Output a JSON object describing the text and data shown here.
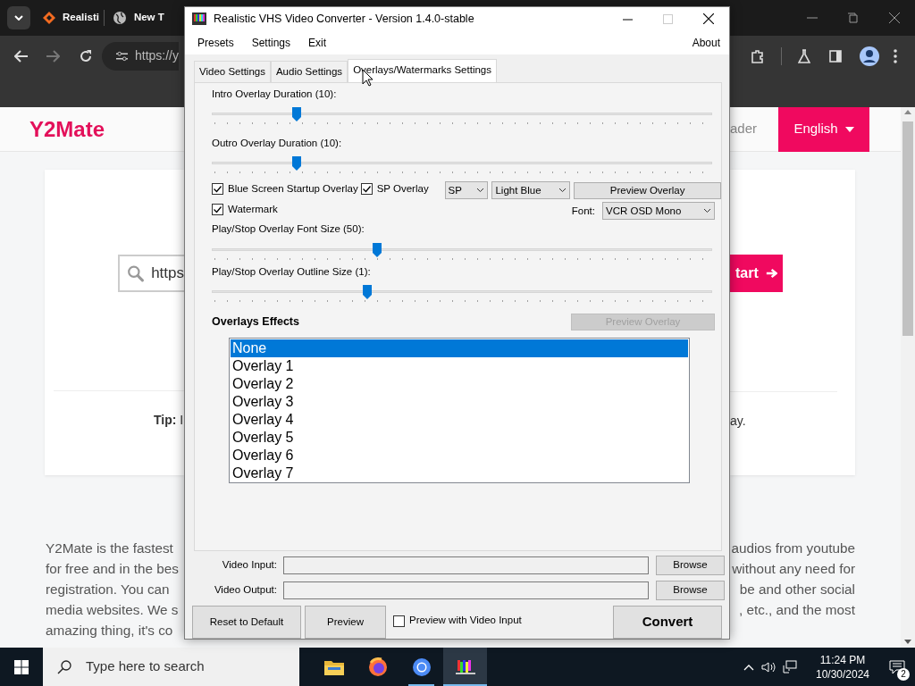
{
  "browser": {
    "tabs": [
      {
        "title": "Realisti",
        "kind": "diamond"
      },
      {
        "title": "New T",
        "kind": "globe"
      }
    ],
    "address": "https://y"
  },
  "page": {
    "logo": "Y2Mate",
    "nav_link": "ader",
    "language_button": "English",
    "search_value": "https",
    "start_button": "tart",
    "tip_label": "Tip:",
    "tip_left": "I",
    "tip_right": "ay.",
    "paragraph_left": [
      "Y2Mate is the fastest",
      "for free and in the bes",
      "registration. You can",
      "media websites. We s",
      "amazing thing, it's co"
    ],
    "paragraph_right": [
      "audios from youtube",
      "without any need for",
      "be and other social",
      ", etc., and the most"
    ]
  },
  "dialog": {
    "title": "Realistic VHS Video Converter - Version 1.4.0-stable",
    "menu": [
      "Presets",
      "Settings",
      "Exit"
    ],
    "about": "About",
    "tabs": [
      {
        "label": "Video Settings",
        "selected": false
      },
      {
        "label": "Audio Settings",
        "selected": false
      },
      {
        "label": "Overlays/Watermarks Settings",
        "selected": true
      }
    ],
    "duration_sliders": [
      {
        "label": "Intro Overlay Duration (10):",
        "level": 0.17
      },
      {
        "label": "Outro Overlay Duration (10):",
        "level": 0.17
      }
    ],
    "checkboxes": [
      {
        "label": "Blue Screen Startup Overlay",
        "checked": true
      },
      {
        "label": "SP Overlay",
        "checked": true
      },
      {
        "label": "Watermark",
        "checked": true
      }
    ],
    "speed_select": "SP",
    "color_select": "Light Blue",
    "preview_overlay_button": {
      "label": "Preview Overlay",
      "disabled": false
    },
    "font_label": "Font:",
    "font_select": "VCR OSD Mono",
    "size_sliders": [
      {
        "label": "Play/Stop Overlay Font Size (50):",
        "level": 0.33
      },
      {
        "label": "Play/Stop Overlay Outline Size (1):",
        "level": 0.31
      }
    ],
    "effects_heading": "Overlays Effects",
    "effects_preview_button": {
      "label": "Preview Overlay",
      "disabled": true
    },
    "effects": [
      {
        "label": "None",
        "selected": true
      },
      {
        "label": "Overlay 1",
        "selected": false
      },
      {
        "label": "Overlay 2",
        "selected": false
      },
      {
        "label": "Overlay 3",
        "selected": false
      },
      {
        "label": "Overlay 4",
        "selected": false
      },
      {
        "label": "Overlay 5",
        "selected": false
      },
      {
        "label": "Overlay 6",
        "selected": false
      },
      {
        "label": "Overlay 7",
        "selected": false
      }
    ],
    "file_rows": [
      {
        "label": "Video Input:",
        "button": "Browse"
      },
      {
        "label": "Video Output:",
        "button": "Browse"
      }
    ],
    "reset_button": "Reset to Default",
    "preview_button": "Preview",
    "preview_input": {
      "label": "Preview with Video Input",
      "checked": false
    },
    "convert_button": "Convert"
  },
  "taskbar": {
    "search_placeholder": "Type here to search",
    "apps": [
      {
        "kind": "folder",
        "running": false,
        "selected": false
      },
      {
        "kind": "orangeglobe",
        "running": false,
        "selected": false
      },
      {
        "kind": "blueglobe",
        "running": true,
        "selected": false
      },
      {
        "kind": "colorbars",
        "running": true,
        "selected": true
      }
    ],
    "time": "11:24 PM",
    "date": "10/30/2024",
    "notifications": "2"
  }
}
